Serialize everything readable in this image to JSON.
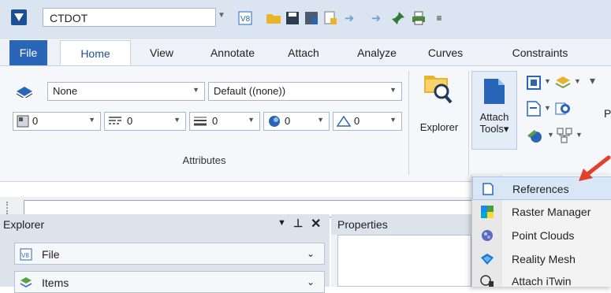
{
  "workspace": {
    "name": "CTDOT"
  },
  "tabs": [
    "File",
    "Home",
    "View",
    "Annotate",
    "Attach",
    "Analyze",
    "Curves",
    "Constraints"
  ],
  "attributes": {
    "level": "None",
    "style": "Default ((none))",
    "row2": [
      "0",
      "0",
      "0",
      "0",
      "0"
    ],
    "group_label": "Attributes"
  },
  "ribbon": {
    "explorer_label": "Explorer",
    "attach_tools_line1": "Attach",
    "attach_tools_line2": "Tools",
    "attach_tools_arrow": "▾",
    "cut_letter": "P"
  },
  "explorer_pane": {
    "title": "Explorer",
    "items": [
      "File",
      "Items"
    ]
  },
  "properties_pane": {
    "title": "Properties"
  },
  "menu": {
    "items": [
      "References",
      "Raster Manager",
      "Point Clouds",
      "Reality Mesh",
      "Attach iTwin"
    ]
  },
  "colors": {
    "file_tab": "#2a66b8",
    "highlight": "#d8e6f6",
    "arrow": "#e2402b"
  }
}
